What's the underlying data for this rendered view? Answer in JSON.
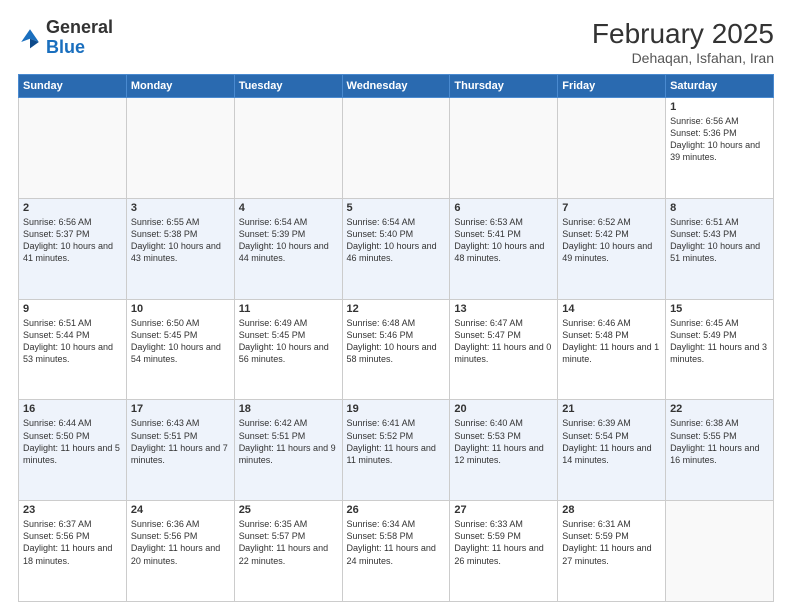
{
  "header": {
    "logo_general": "General",
    "logo_blue": "Blue",
    "month_year": "February 2025",
    "location": "Dehaqan, Isfahan, Iran"
  },
  "days_of_week": [
    "Sunday",
    "Monday",
    "Tuesday",
    "Wednesday",
    "Thursday",
    "Friday",
    "Saturday"
  ],
  "weeks": [
    {
      "alt": false,
      "days": [
        {
          "num": "",
          "text": "",
          "empty": true
        },
        {
          "num": "",
          "text": "",
          "empty": true
        },
        {
          "num": "",
          "text": "",
          "empty": true
        },
        {
          "num": "",
          "text": "",
          "empty": true
        },
        {
          "num": "",
          "text": "",
          "empty": true
        },
        {
          "num": "",
          "text": "",
          "empty": true
        },
        {
          "num": "1",
          "text": "Sunrise: 6:56 AM\nSunset: 5:36 PM\nDaylight: 10 hours\nand 39 minutes.",
          "empty": false
        }
      ]
    },
    {
      "alt": true,
      "days": [
        {
          "num": "2",
          "text": "Sunrise: 6:56 AM\nSunset: 5:37 PM\nDaylight: 10 hours\nand 41 minutes.",
          "empty": false
        },
        {
          "num": "3",
          "text": "Sunrise: 6:55 AM\nSunset: 5:38 PM\nDaylight: 10 hours\nand 43 minutes.",
          "empty": false
        },
        {
          "num": "4",
          "text": "Sunrise: 6:54 AM\nSunset: 5:39 PM\nDaylight: 10 hours\nand 44 minutes.",
          "empty": false
        },
        {
          "num": "5",
          "text": "Sunrise: 6:54 AM\nSunset: 5:40 PM\nDaylight: 10 hours\nand 46 minutes.",
          "empty": false
        },
        {
          "num": "6",
          "text": "Sunrise: 6:53 AM\nSunset: 5:41 PM\nDaylight: 10 hours\nand 48 minutes.",
          "empty": false
        },
        {
          "num": "7",
          "text": "Sunrise: 6:52 AM\nSunset: 5:42 PM\nDaylight: 10 hours\nand 49 minutes.",
          "empty": false
        },
        {
          "num": "8",
          "text": "Sunrise: 6:51 AM\nSunset: 5:43 PM\nDaylight: 10 hours\nand 51 minutes.",
          "empty": false
        }
      ]
    },
    {
      "alt": false,
      "days": [
        {
          "num": "9",
          "text": "Sunrise: 6:51 AM\nSunset: 5:44 PM\nDaylight: 10 hours\nand 53 minutes.",
          "empty": false
        },
        {
          "num": "10",
          "text": "Sunrise: 6:50 AM\nSunset: 5:45 PM\nDaylight: 10 hours\nand 54 minutes.",
          "empty": false
        },
        {
          "num": "11",
          "text": "Sunrise: 6:49 AM\nSunset: 5:45 PM\nDaylight: 10 hours\nand 56 minutes.",
          "empty": false
        },
        {
          "num": "12",
          "text": "Sunrise: 6:48 AM\nSunset: 5:46 PM\nDaylight: 10 hours\nand 58 minutes.",
          "empty": false
        },
        {
          "num": "13",
          "text": "Sunrise: 6:47 AM\nSunset: 5:47 PM\nDaylight: 11 hours\nand 0 minutes.",
          "empty": false
        },
        {
          "num": "14",
          "text": "Sunrise: 6:46 AM\nSunset: 5:48 PM\nDaylight: 11 hours\nand 1 minute.",
          "empty": false
        },
        {
          "num": "15",
          "text": "Sunrise: 6:45 AM\nSunset: 5:49 PM\nDaylight: 11 hours\nand 3 minutes.",
          "empty": false
        }
      ]
    },
    {
      "alt": true,
      "days": [
        {
          "num": "16",
          "text": "Sunrise: 6:44 AM\nSunset: 5:50 PM\nDaylight: 11 hours\nand 5 minutes.",
          "empty": false
        },
        {
          "num": "17",
          "text": "Sunrise: 6:43 AM\nSunset: 5:51 PM\nDaylight: 11 hours\nand 7 minutes.",
          "empty": false
        },
        {
          "num": "18",
          "text": "Sunrise: 6:42 AM\nSunset: 5:51 PM\nDaylight: 11 hours\nand 9 minutes.",
          "empty": false
        },
        {
          "num": "19",
          "text": "Sunrise: 6:41 AM\nSunset: 5:52 PM\nDaylight: 11 hours\nand 11 minutes.",
          "empty": false
        },
        {
          "num": "20",
          "text": "Sunrise: 6:40 AM\nSunset: 5:53 PM\nDaylight: 11 hours\nand 12 minutes.",
          "empty": false
        },
        {
          "num": "21",
          "text": "Sunrise: 6:39 AM\nSunset: 5:54 PM\nDaylight: 11 hours\nand 14 minutes.",
          "empty": false
        },
        {
          "num": "22",
          "text": "Sunrise: 6:38 AM\nSunset: 5:55 PM\nDaylight: 11 hours\nand 16 minutes.",
          "empty": false
        }
      ]
    },
    {
      "alt": false,
      "days": [
        {
          "num": "23",
          "text": "Sunrise: 6:37 AM\nSunset: 5:56 PM\nDaylight: 11 hours\nand 18 minutes.",
          "empty": false
        },
        {
          "num": "24",
          "text": "Sunrise: 6:36 AM\nSunset: 5:56 PM\nDaylight: 11 hours\nand 20 minutes.",
          "empty": false
        },
        {
          "num": "25",
          "text": "Sunrise: 6:35 AM\nSunset: 5:57 PM\nDaylight: 11 hours\nand 22 minutes.",
          "empty": false
        },
        {
          "num": "26",
          "text": "Sunrise: 6:34 AM\nSunset: 5:58 PM\nDaylight: 11 hours\nand 24 minutes.",
          "empty": false
        },
        {
          "num": "27",
          "text": "Sunrise: 6:33 AM\nSunset: 5:59 PM\nDaylight: 11 hours\nand 26 minutes.",
          "empty": false
        },
        {
          "num": "28",
          "text": "Sunrise: 6:31 AM\nSunset: 5:59 PM\nDaylight: 11 hours\nand 27 minutes.",
          "empty": false
        },
        {
          "num": "",
          "text": "",
          "empty": true
        }
      ]
    }
  ]
}
